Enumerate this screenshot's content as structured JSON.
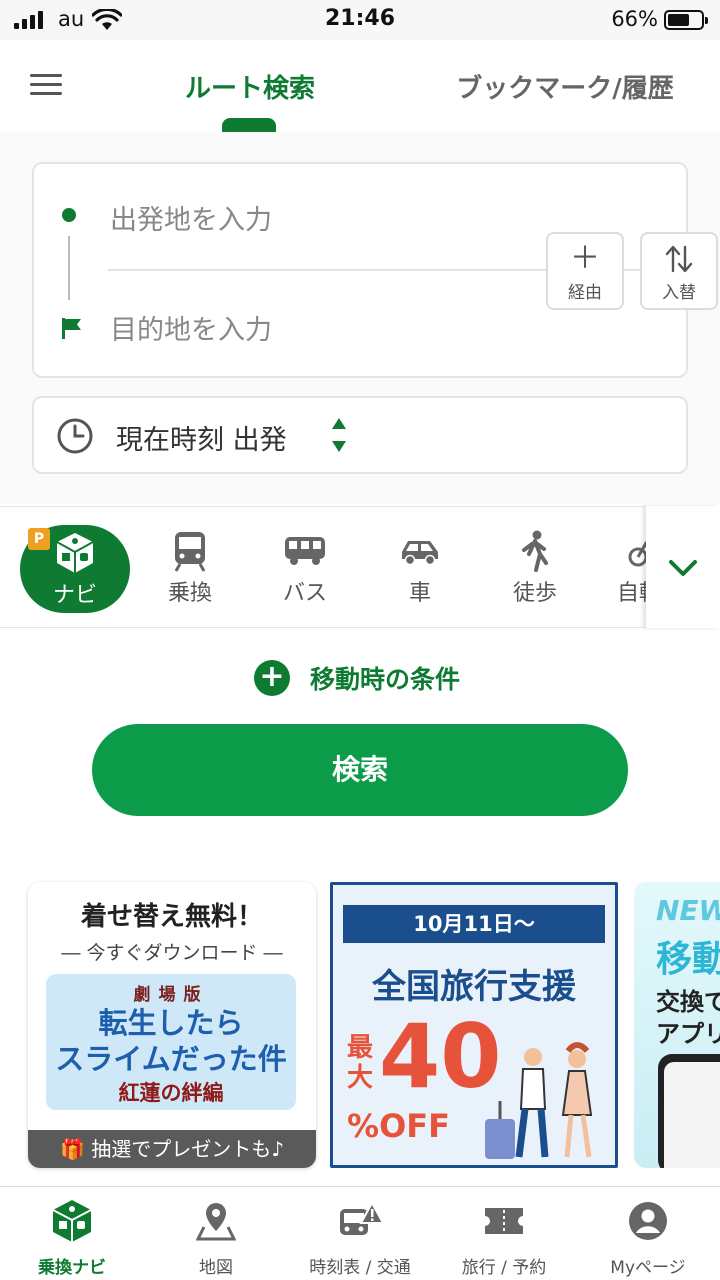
{
  "status_bar": {
    "carrier": "au",
    "time": "21:46",
    "battery_percent": "66%",
    "battery_level": 0.66
  },
  "header": {
    "menu_icon": "hamburger-icon",
    "tab_route": "ルート検索",
    "tab_bookmark": "ブックマーク/履歴",
    "active_tab": "route"
  },
  "route": {
    "from_placeholder": "出発地を入力",
    "to_placeholder": "目的地を入力",
    "via_label": "経由",
    "swap_label": "入替",
    "time_label": "現在時刻 出発"
  },
  "modes": {
    "items": [
      {
        "label": "ナビ",
        "icon": "navi-cube-icon",
        "active": true
      },
      {
        "label": "乗換",
        "icon": "train-icon"
      },
      {
        "label": "バス",
        "icon": "bus-icon"
      },
      {
        "label": "車",
        "icon": "car-icon"
      },
      {
        "label": "徒歩",
        "icon": "walk-icon"
      },
      {
        "label": "自転車",
        "icon": "bicycle-icon"
      }
    ],
    "navi_badge": "P"
  },
  "conditions_label": "移動時の条件",
  "search_label": "検索",
  "banners": {
    "b1": {
      "title": "着せ替え無料！",
      "subtitle": "― 今すぐダウンロード ―",
      "art_top": "劇場版",
      "art_line1": "転生したら",
      "art_line2": "スライムだった件",
      "art_line3": "紅蓮の絆編",
      "footer": "抽選でプレゼントも♪"
    },
    "b2": {
      "date": "10月11日～",
      "headline": "全国旅行支援",
      "max_label": "最大",
      "percent": "40",
      "off_label": "%OFF"
    },
    "b3": {
      "new_label": "NEW",
      "line1": "移動",
      "line2": "交換で",
      "line3": "アプリ"
    }
  },
  "bottom_nav": {
    "items": [
      {
        "label": "乗換ナビ",
        "icon": "navi-cube-icon",
        "active": true
      },
      {
        "label": "地図",
        "icon": "map-pin-icon"
      },
      {
        "label": "時刻表 / 交通",
        "icon": "timetable-icon"
      },
      {
        "label": "旅行 / 予約",
        "icon": "ticket-icon"
      },
      {
        "label": "Myページ",
        "icon": "user-icon"
      }
    ]
  },
  "colors": {
    "brand_green": "#0e7a32",
    "search_green": "#0c9b48",
    "promo_red": "#e6533a",
    "promo_blue": "#1a4e8c"
  }
}
